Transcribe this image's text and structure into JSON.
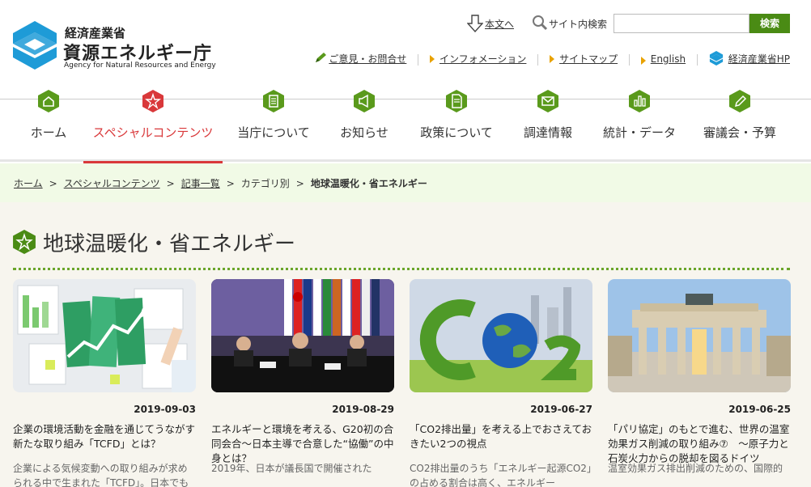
{
  "header": {
    "logo_sub": "経済産業省",
    "logo_main": "資源エネルギー庁",
    "logo_en": "Agency for Natural Resources and Energy",
    "skip_label": "本文へ",
    "search_label": "サイト内検索",
    "search_value": "",
    "search_button": "検索",
    "links": {
      "opinion": "ご意見・お問合せ",
      "info": "インフォメーション",
      "sitemap": "サイトマップ",
      "english": "English",
      "meti": "経済産業省HP"
    }
  },
  "nav": {
    "items": [
      {
        "label": "ホーム",
        "icon": "home-icon"
      },
      {
        "label": "スペシャルコンテンツ",
        "icon": "star-icon"
      },
      {
        "label": "当庁について",
        "icon": "building-icon"
      },
      {
        "label": "お知らせ",
        "icon": "megaphone-icon"
      },
      {
        "label": "政策について",
        "icon": "document-icon"
      },
      {
        "label": "調達情報",
        "icon": "mail-icon"
      },
      {
        "label": "統計・データ",
        "icon": "bar-chart-icon"
      },
      {
        "label": "審議会・予算",
        "icon": "pencil-icon"
      }
    ]
  },
  "breadcrumb": {
    "items": [
      "ホーム",
      "スペシャルコンテンツ",
      "記事一覧",
      "カテゴリ別"
    ],
    "current": "地球温暖化・省エネルギー",
    "separator": ">"
  },
  "page": {
    "title": "地球温暖化・省エネルギー"
  },
  "articles": [
    {
      "date": "2019-09-03",
      "title": "企業の環境活動を金融を通じてうながす新たな取り組み「TCFD」とは？",
      "desc": "企業による気候変動への取り組みが求められる中で生まれた「TCFD」。日本でも"
    },
    {
      "date": "2019-08-29",
      "title": "エネルギーと環境を考える、G20初の合同会合～日本主導で合意した“協働”の中身とは？",
      "desc": "2019年、日本が議長国で開催された"
    },
    {
      "date": "2019-06-27",
      "title": "「CO2排出量」を考える上でおさえておきたい2つの視点",
      "desc": "CO2排出量のうち「エネルギー起源CO2」の占める割合は高く、エネルギー"
    },
    {
      "date": "2019-06-25",
      "title": "「パリ協定」のもとで進む、世界の温室効果ガス削減の取り組み⑦　～原子力と石炭火力からの脱却を図るドイツ",
      "desc": "温室効果ガス排出削減のための、国際的"
    }
  ],
  "colors": {
    "brand_green": "#4a8b14",
    "accent_red": "#d9383a",
    "logo_blue": "#1e9bd7",
    "breadcrumb_bg": "#f1fae6",
    "content_bg": "#f7f5ee"
  }
}
